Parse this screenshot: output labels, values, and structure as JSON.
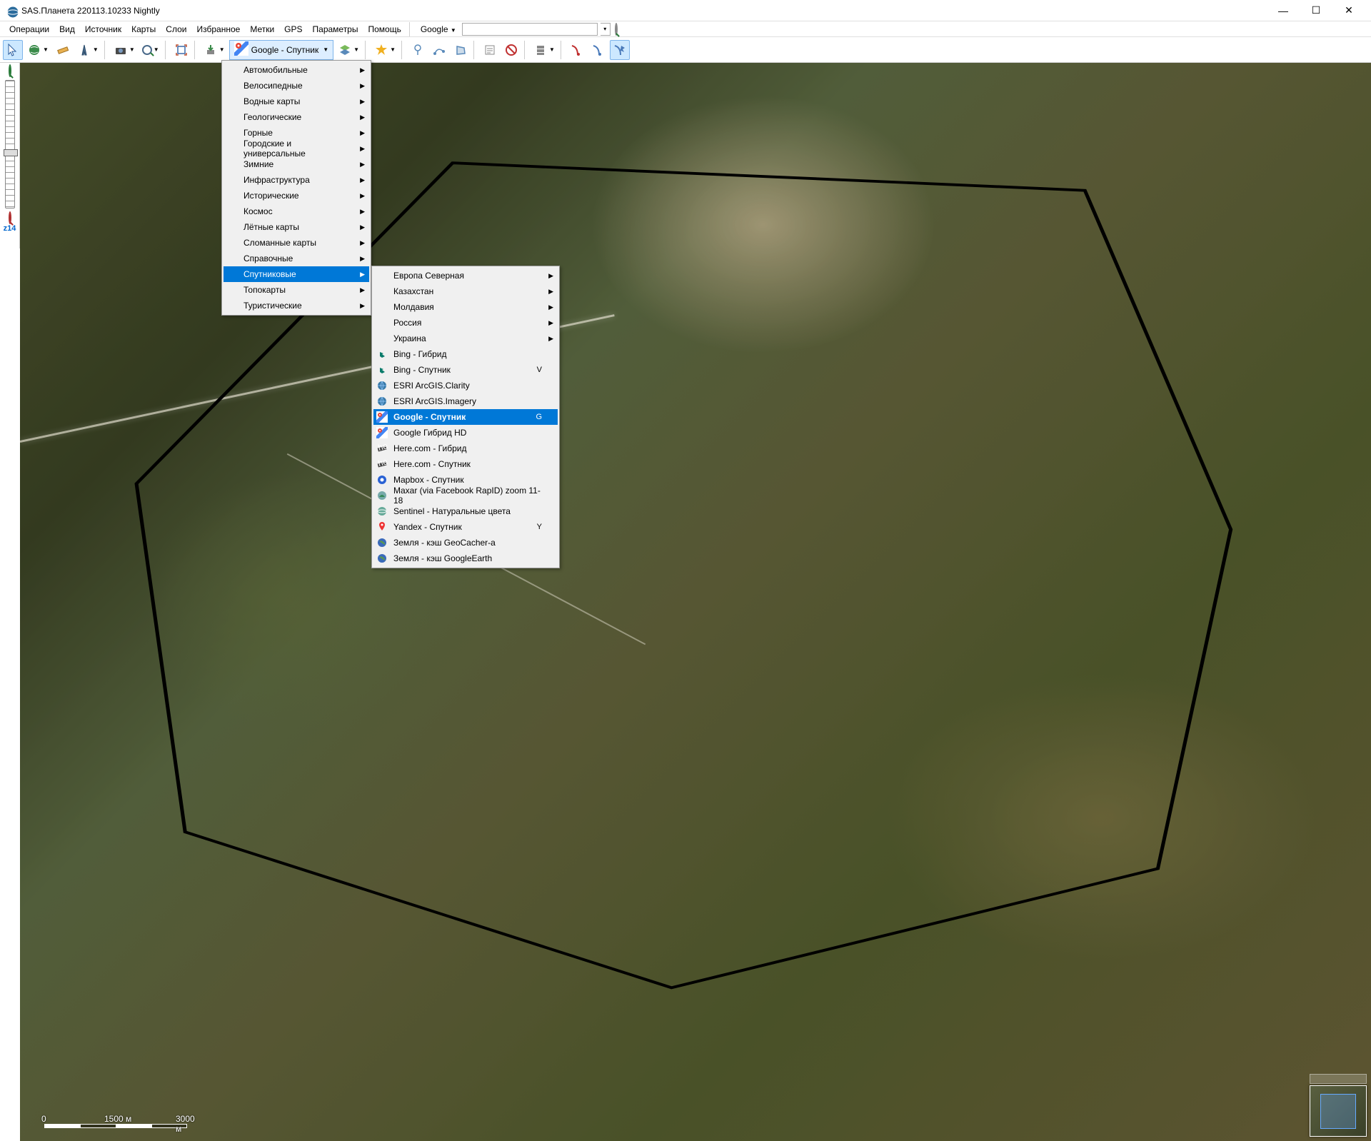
{
  "window": {
    "title": "SAS.Планета 220113.10233 Nightly"
  },
  "menu": {
    "items": [
      "Операции",
      "Вид",
      "Источник",
      "Карты",
      "Слои",
      "Избранное",
      "Метки",
      "GPS",
      "Параметры",
      "Помощь"
    ],
    "search_provider": "Google",
    "search_value": ""
  },
  "toolbar": {
    "map_selector_label": "Google - Спутник"
  },
  "zoom": {
    "level_label": "z14"
  },
  "scale": {
    "zero": "0",
    "mid": "1500 м",
    "end": "3000 м"
  },
  "category_menu": {
    "items": [
      {
        "label": "Автомобильные",
        "sub": true
      },
      {
        "label": "Велосипедные",
        "sub": true
      },
      {
        "label": "Водные карты",
        "sub": true
      },
      {
        "label": "Геологические",
        "sub": true
      },
      {
        "label": "Горные",
        "sub": true
      },
      {
        "label": "Городские и универсальные",
        "sub": true
      },
      {
        "label": "Зимние",
        "sub": true
      },
      {
        "label": "Инфраструктура",
        "sub": true
      },
      {
        "label": "Исторические",
        "sub": true
      },
      {
        "label": "Космос",
        "sub": true
      },
      {
        "label": "Лётные карты",
        "sub": true
      },
      {
        "label": "Сломанные карты",
        "sub": true
      },
      {
        "label": "Справочные",
        "sub": true
      },
      {
        "label": "Спутниковые",
        "sub": true,
        "selected": true
      },
      {
        "label": "Топокарты",
        "sub": true
      },
      {
        "label": "Туристические",
        "sub": true
      }
    ]
  },
  "satellite_submenu": {
    "items": [
      {
        "label": "Европа Северная",
        "sub": true
      },
      {
        "label": "Казахстан",
        "sub": true
      },
      {
        "label": "Молдавия",
        "sub": true
      },
      {
        "label": "Россия",
        "sub": true
      },
      {
        "label": "Украина",
        "sub": true
      },
      {
        "label": "Bing - Гибрид",
        "icon": "bing"
      },
      {
        "label": "Bing - Спутник",
        "icon": "bing",
        "shortcut": "V"
      },
      {
        "label": "ESRI ArcGIS.Clarity",
        "icon": "globe"
      },
      {
        "label": "ESRI ArcGIS.Imagery",
        "icon": "globe"
      },
      {
        "label": "Google - Спутник",
        "icon": "gmap",
        "shortcut": "G",
        "selected": true
      },
      {
        "label": "Google Гибрид HD",
        "icon": "gmap"
      },
      {
        "label": "Here.com - Гибрид",
        "icon": "here"
      },
      {
        "label": "Here.com - Спутник",
        "icon": "here"
      },
      {
        "label": "Mapbox - Спутник",
        "icon": "mapbox"
      },
      {
        "label": "Maxar (via Facebook RapID) zoom 11-18",
        "icon": "maxar"
      },
      {
        "label": "Sentinel - Натуральные цвета",
        "icon": "sentinel"
      },
      {
        "label": "Yandex - Спутник",
        "icon": "yandex",
        "shortcut": "Y"
      },
      {
        "label": "Земля - кэш GeoCacher-a",
        "icon": "earth"
      },
      {
        "label": "Земля - кэш GoogleEarth",
        "icon": "earth"
      }
    ]
  }
}
